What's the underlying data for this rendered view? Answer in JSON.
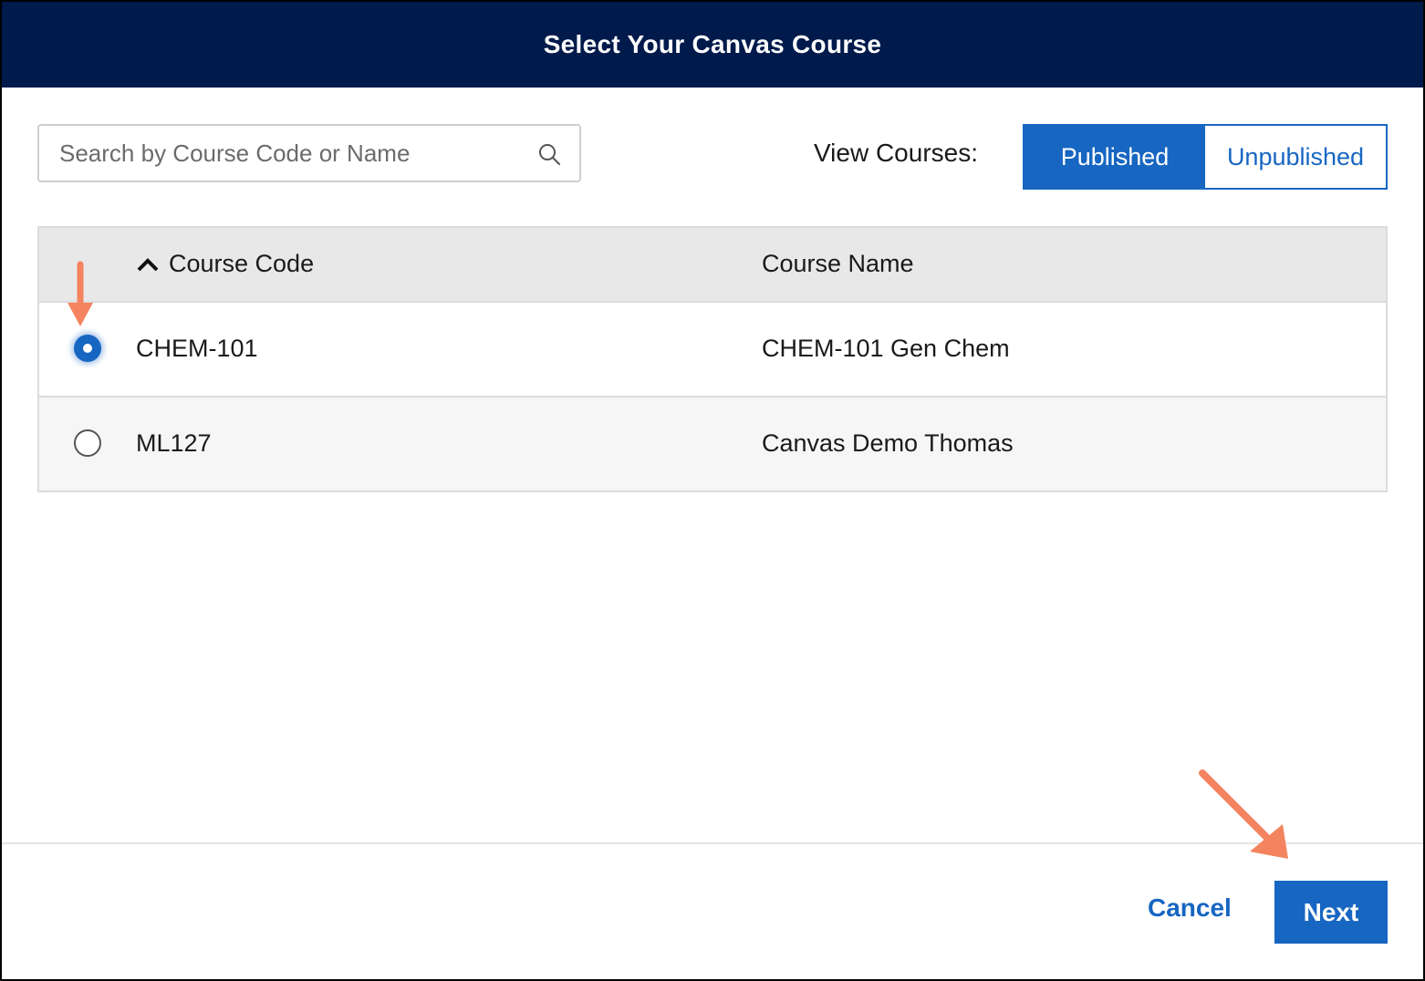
{
  "dialog": {
    "title": "Select Your Canvas Course"
  },
  "search": {
    "placeholder": "Search by Course Code or Name",
    "value": "",
    "icon": "search-icon"
  },
  "view_filter": {
    "label": "View Courses:",
    "options": [
      {
        "label": "Published",
        "active": true
      },
      {
        "label": "Unpublished",
        "active": false
      }
    ]
  },
  "table": {
    "columns": [
      {
        "label": "Course Code",
        "sort": "ascending",
        "sort_icon": "chevron-up-icon"
      },
      {
        "label": "Course Name"
      }
    ],
    "rows": [
      {
        "code": "CHEM-101",
        "name": "CHEM-101 Gen Chem",
        "selected": true
      },
      {
        "code": "ML127",
        "name": "Canvas Demo Thomas",
        "selected": false
      }
    ]
  },
  "footer": {
    "cancel_label": "Cancel",
    "next_label": "Next"
  },
  "annotations": {
    "arrow_color": "#f4845f",
    "items": [
      "arrow pointing to CHEM-101 radio",
      "arrow pointing to Next button"
    ]
  },
  "colors": {
    "header_bg": "#001a4b",
    "accent": "#1766c2"
  }
}
